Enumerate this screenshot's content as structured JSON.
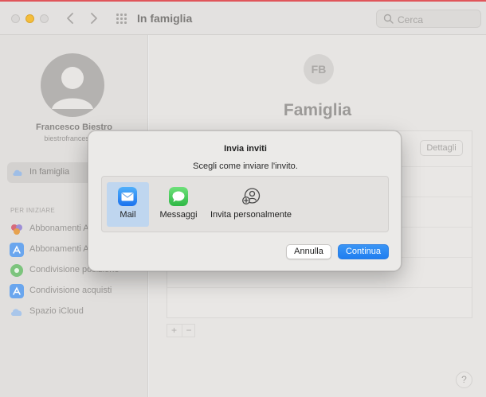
{
  "window": {
    "title": "In famiglia",
    "search_placeholder": "Cerca"
  },
  "sidebar": {
    "user_name": "Francesco Biestro",
    "user_email": "biestrofrancesco@",
    "selected_item": "In famiglia",
    "section_label": "PER INIZIARE",
    "items": [
      {
        "label": "Abbonamenti A",
        "icon": "subscriptions-icon",
        "color": "#d86b7a"
      },
      {
        "label": "Abbonamenti A",
        "icon": "app-store-icon",
        "color": "#4a8fe6"
      },
      {
        "label": "Condivisione posizione",
        "icon": "find-my-icon",
        "color": "#58b35a"
      },
      {
        "label": "Condivisione acquisti",
        "icon": "app-store-icon",
        "color": "#4a8fe6"
      },
      {
        "label": "Spazio iCloud",
        "icon": "icloud-icon",
        "color": "#8fb6e6"
      }
    ]
  },
  "main": {
    "badge_initials": "FB",
    "title": "Famiglia",
    "details_button": "Dettagli",
    "add_label": "+",
    "remove_label": "−",
    "help_label": "?"
  },
  "dialog": {
    "title": "Invia inviti",
    "subtitle": "Scegli come inviare l'invito.",
    "options": [
      {
        "label": "Mail",
        "icon": "mail-icon",
        "selected": true
      },
      {
        "label": "Messaggi",
        "icon": "messages-icon",
        "selected": false
      },
      {
        "label": "Invita personalmente",
        "icon": "invite-in-person-icon",
        "selected": false
      }
    ],
    "cancel_label": "Annulla",
    "continue_label": "Continua"
  },
  "colors": {
    "accent": "#1f7ef0",
    "selection": "#bfd6ef",
    "mail_blue": "#2c8cf4",
    "messages_green": "#43c75a",
    "minimize_yellow": "#f4bd3b"
  }
}
